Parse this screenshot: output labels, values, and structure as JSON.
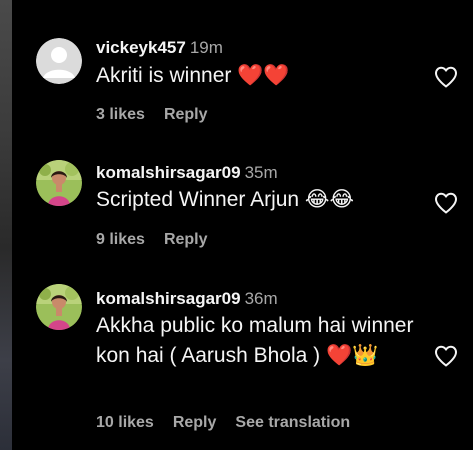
{
  "comments": [
    {
      "username": "vickeyk457",
      "time": "19m",
      "text": "Akriti is winner ❤️❤️",
      "likes": "3 likes",
      "reply": "Reply"
    },
    {
      "username": "komalshirsagar09",
      "time": "35m",
      "text": "Scripted Winner Arjun 😂😂",
      "likes": "9 likes",
      "reply": "Reply"
    },
    {
      "username": "komalshirsagar09",
      "time": "36m",
      "text": "Akkha public ko malum hai winner kon hai ( Aarush Bhola ) ❤️👑",
      "likes": "10 likes",
      "reply": "Reply",
      "see_translation": "See translation"
    }
  ],
  "icons": {
    "avatar_default": "default-avatar-icon",
    "like": "heart-outline-icon"
  },
  "colors": {
    "background": "#000000",
    "text_primary": "#f5f5f5",
    "text_secondary": "#a8a8a8",
    "avatar_default": "#dbdbdb"
  }
}
